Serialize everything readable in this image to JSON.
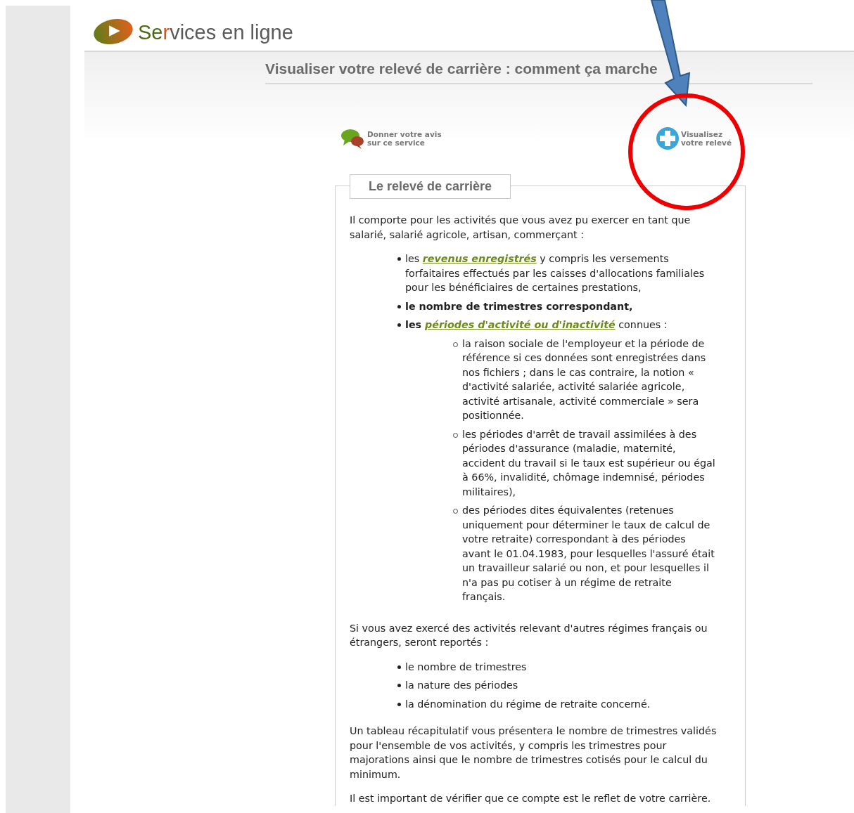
{
  "brand": {
    "parts": [
      {
        "text": "Se",
        "color": "#4b6a14"
      },
      {
        "text": "r",
        "color": "#d9531e"
      },
      {
        "text": "vices en ligne",
        "color": "#5a5a5a"
      }
    ]
  },
  "page_title": "Visualiser votre relevé de carrière : comment ça marche",
  "actions": [
    {
      "kind": "feedback",
      "label": "Donner votre avis sur ce service"
    },
    {
      "kind": "view",
      "label": "Visualisez votre relevé"
    }
  ],
  "section": {
    "title": "Le relevé de carrière",
    "blocks": [
      {
        "kind": "paragraph",
        "segments": [
          {
            "text": "Il comporte pour les activités que vous avez pu exercer en tant que salarié, salarié agricole, artisan, commerçant :"
          }
        ]
      },
      {
        "kind": "list",
        "items": [
          {
            "segments": [
              {
                "text": "les "
              },
              {
                "text": "revenus enregistrés",
                "kind": "link"
              },
              {
                "text": " y compris les versements forfaitaires effectués par les caisses d'allocations familiales pour les bénéficiaires de certaines prestations,"
              }
            ]
          },
          {
            "segments": [
              {
                "text": "le nombre de trimestres correspondant,",
                "kind": "bold"
              }
            ]
          },
          {
            "segments": [
              {
                "text": "les ",
                "kind": "bold"
              },
              {
                "text": "périodes d'activité ou d'inactivité",
                "kind": "link"
              },
              {
                "text": " connues :"
              }
            ],
            "children": [
              {
                "segments": [
                  {
                    "text": "la raison sociale de l'employeur et la période de référence si ces données sont enregistrées dans nos fichiers ; dans le cas contraire, la notion « d'activité salariée, activité salariée agricole, activité artisanale, activité commerciale » sera positionnée."
                  }
                ]
              },
              {
                "segments": [
                  {
                    "text": "les périodes d'arrêt de travail assimilées à des périodes d'assurance (maladie, maternité, accident du travail si le taux est supérieur ou égal à 66%, invalidité, chômage indemnisé, périodes militaires),"
                  }
                ]
              },
              {
                "segments": [
                  {
                    "text": "des périodes dites équivalentes (retenues uniquement pour déterminer le taux de calcul de votre retraite) correspondant à des périodes avant le 01.04.1983, pour lesquelles l'assuré était un travailleur salarié ou non, et pour lesquelles il n'a pas pu cotiser à un régime de retraite français."
                  }
                ]
              }
            ]
          }
        ]
      },
      {
        "kind": "paragraph",
        "segments": [
          {
            "text": "Si vous avez exercé des activités relevant d'autres régimes français ou étrangers, seront reportés :"
          }
        ]
      },
      {
        "kind": "list",
        "items": [
          {
            "segments": [
              {
                "text": "le nombre de trimestres"
              }
            ]
          },
          {
            "segments": [
              {
                "text": "la nature des périodes"
              }
            ]
          },
          {
            "segments": [
              {
                "text": "la dénomination du régime de retraite concerné."
              }
            ]
          }
        ]
      },
      {
        "kind": "paragraph",
        "segments": [
          {
            "text": "Un tableau récapitulatif vous présentera le nombre de trimestres validés pour l'ensemble de vos activités, y compris les trimestres pour majorations ainsi que le nombre de trimestres cotisés pour le calcul du minimum."
          }
        ]
      },
      {
        "kind": "paragraph",
        "segments": [
          {
            "text": "Il est important de vérifier que ce compte est le reflet de votre carrière."
          }
        ]
      }
    ]
  }
}
